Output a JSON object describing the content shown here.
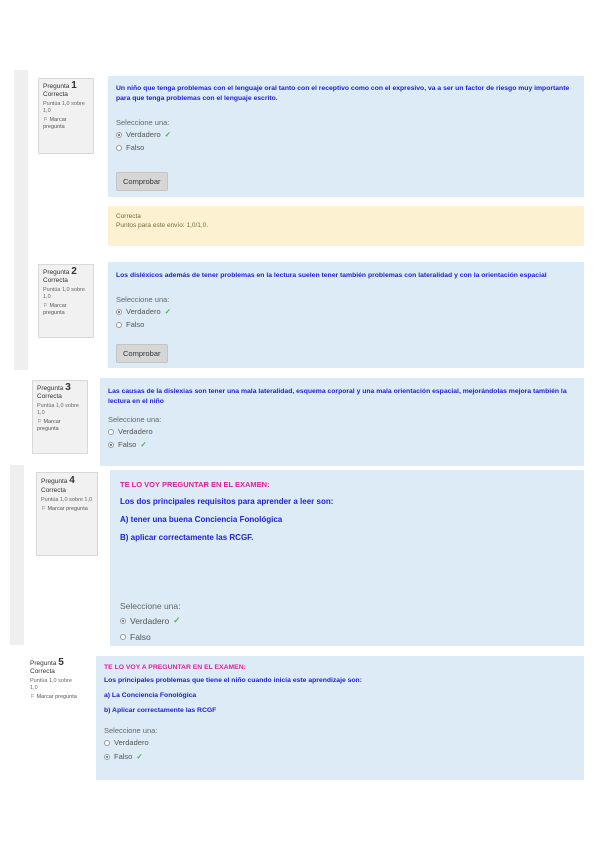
{
  "q1": {
    "label": "Pregunta",
    "number": "1",
    "status": "Correcta",
    "points": "Puntúa 1,0 sobre 1,0",
    "flag": "Marcar pregunta",
    "text": "Un niño que tenga problemas con el lenguaje oral tanto con el receptivo como con el expresivo, va a ser un factor de riesgo muy importante para que tenga problemas con el lenguaje escrito.",
    "select": "Seleccione una:",
    "option_true": "Verdadero",
    "option_false": "Falso",
    "check_button": "Comprobar",
    "feedback_status": "Correcta",
    "feedback_points": "Puntos para este envío: 1,0/1,0."
  },
  "q2": {
    "label": "Pregunta",
    "number": "2",
    "status": "Correcta",
    "points": "Puntúa 1,0 sobre 1,0",
    "flag": "Marcar pregunta",
    "text": "Los disléxicos además de tener problemas en la lectura suelen tener también problemas con lateralidad y con la orientación espacial",
    "select": "Seleccione una:",
    "option_true": "Verdadero",
    "option_false": "Falso",
    "check_button": "Comprobar"
  },
  "q3": {
    "label": "Pregunta",
    "number": "3",
    "status": "Correcta",
    "points": "Puntúa 1,0 sobre 1,0",
    "flag": "Marcar pregunta",
    "text": "Las causas de la dislexias son tener una mala lateralidad, esquema corporal y una mala orientación espacial, mejorándolas mejora también la lectura en el niño",
    "select": "Seleccione una:",
    "option_true": "Verdadero",
    "option_false": "Falso"
  },
  "q4": {
    "label": "Pregunta",
    "number": "4",
    "status": "Correcta",
    "points": "Puntúa 1,0 sobre 1,0",
    "flag": "Marcar pregunta",
    "heading": "TE LO VOY PREGUNTAR EN EL EXAMEN:",
    "line1": "Los dos principales requisitos para aprender a leer son:",
    "line2": "A) tener una buena Conciencia Fonológica",
    "line3": "B) aplicar correctamente las RCGF.",
    "select": "Seleccione una:",
    "option_true": "Verdadero",
    "option_false": "Falso"
  },
  "q5": {
    "label": "Pregunta",
    "number": "5",
    "status": "Correcta",
    "points": "Puntúa 1,0 sobre 1,0",
    "flag": "Marcar pregunta",
    "heading": "TE LO VOY A PREGUNTAR EN EL EXAMEN:",
    "line1": "Los principales problemas que tiene el niño cuando inicia este aprendizaje son:",
    "line2": "a) La Conciencia Fonológica",
    "line3": "b) Aplicar correctamente las RCGF",
    "select": "Seleccione una:",
    "option_true": "Verdadero",
    "option_false": "Falso"
  },
  "checkmark": "✓",
  "colors": {
    "question_bg": "#dcebf5",
    "question_text": "#1f20d8",
    "exam_heading": "#e0209a",
    "correct": "#4bb04b",
    "feedback_bg": "#fcf1d1"
  }
}
